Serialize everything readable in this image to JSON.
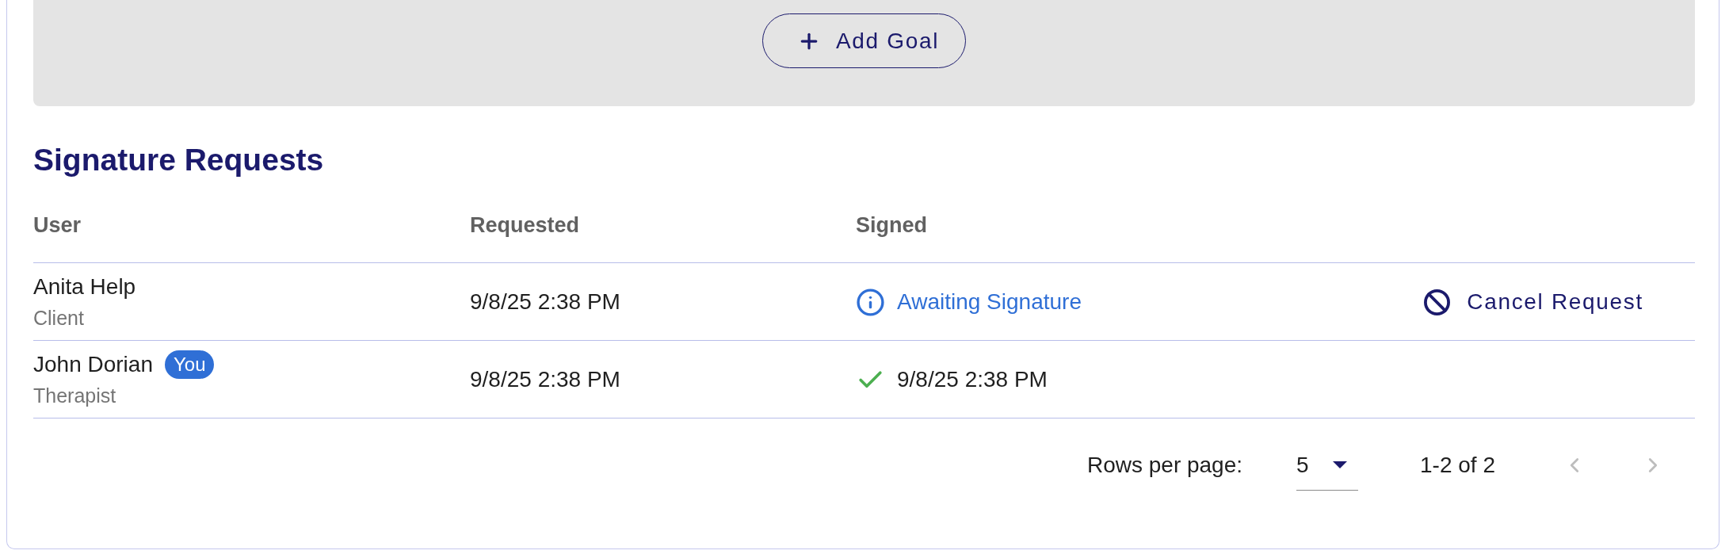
{
  "goals_panel": {
    "add_button": "Add Goal"
  },
  "section_title": "Signature Requests",
  "table": {
    "columns": [
      "User",
      "Requested",
      "Signed"
    ],
    "rows": [
      {
        "user": "Anita Help",
        "role": "Client",
        "requested": "9/8/25 2:38 PM",
        "signed": {
          "kind": "awaiting",
          "text": "Awaiting Signature"
        },
        "action": "Cancel Request"
      },
      {
        "user": "John Dorian",
        "badge": "You",
        "role": "Therapist",
        "requested": "9/8/25 2:38 PM",
        "signed": {
          "kind": "signed",
          "text": "9/8/25 2:38 PM"
        }
      }
    ]
  },
  "pagination": {
    "rows_per_page_label": "Rows per page:",
    "rows_per_page": "5",
    "range": "1-2 of 2",
    "previous_disabled": true,
    "next_disabled": true
  }
}
